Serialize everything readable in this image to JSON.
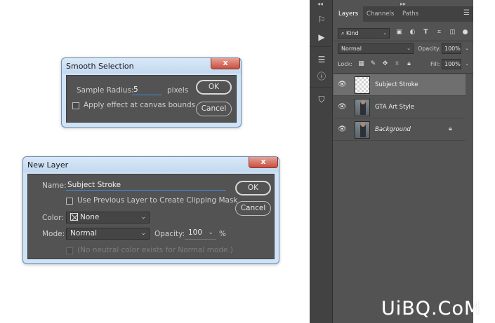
{
  "smooth_selection": {
    "title": "Smooth Selection",
    "close": "x",
    "sample_radius_label": "Sample Radius:",
    "sample_radius_value": "5",
    "units": "pixels",
    "apply_canvas_label": "Apply effect at canvas bounds",
    "apply_canvas_checked": false,
    "ok": "OK",
    "cancel": "Cancel"
  },
  "new_layer": {
    "title": "New Layer",
    "close": "x",
    "name_label": "Name:",
    "name_value": "Subject Stroke",
    "clipping_label": "Use Previous Layer to Create Clipping Mask",
    "clipping_checked": false,
    "color_label": "Color:",
    "color_value": "None",
    "mode_label": "Mode:",
    "mode_value": "Normal",
    "opacity_label": "Opacity:",
    "opacity_value": "100",
    "opacity_unit": "%",
    "neutral_label": "(No neutral color exists for Normal mode.)",
    "ok": "OK",
    "cancel": "Cancel"
  },
  "layers_panel": {
    "tabs": [
      {
        "label": "Layers",
        "active": true
      },
      {
        "label": "Channels",
        "active": false
      },
      {
        "label": "Paths",
        "active": false
      }
    ],
    "filter_kind": "Kind",
    "blend_mode": "Normal",
    "opacity_label": "Opacity:",
    "opacity_value": "100%",
    "lock_label": "Lock:",
    "fill_label": "Fill:",
    "fill_value": "100%",
    "layers": [
      {
        "name": "Subject Stroke",
        "selected": true,
        "thumb": "transparent",
        "locked": false,
        "italic": false
      },
      {
        "name": "GTA Art Style",
        "selected": false,
        "thumb": "photo",
        "locked": false,
        "italic": false
      },
      {
        "name": "Background",
        "selected": false,
        "thumb": "photo",
        "locked": true,
        "italic": true
      }
    ]
  },
  "watermark": "UiBQ.CoM",
  "colors": {
    "panel_bg": "#535353",
    "dialog_frame": "#cfe3f6",
    "close_button": "#c7503f",
    "field_underline": "#3d8ee0",
    "selected_layer": "#6f6f6f"
  },
  "icons": {
    "tools": [
      "history-brush-icon",
      "play-icon",
      "adjust-icon",
      "info-icon",
      "stamp-icon"
    ],
    "filters": [
      "image-filter-icon",
      "adjustment-filter-icon",
      "type-filter-icon",
      "shape-filter-icon",
      "smart-object-filter-icon",
      "filter-toggle-icon"
    ],
    "locks": [
      "lock-transparent-icon",
      "lock-image-icon",
      "lock-position-icon",
      "lock-artboard-icon",
      "lock-all-icon"
    ]
  }
}
